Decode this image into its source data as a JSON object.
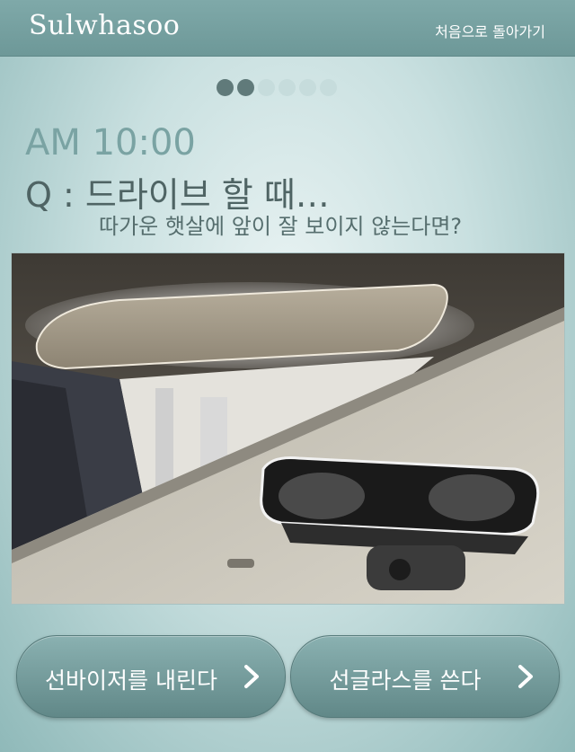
{
  "header": {
    "logo": "Sulwhasoo",
    "home_link": "처음으로 돌아가기"
  },
  "progress": {
    "current_step": 2,
    "total_steps": 6
  },
  "scenario": {
    "time": "AM 10:00",
    "question": "Q : 드라이브 할 때…",
    "subquestion": "따가운 햇살에 앞이 잘 보이지 않는다면?"
  },
  "choices": [
    {
      "label": "선바이저를 내린다",
      "icon": "chevron-right-icon"
    },
    {
      "label": "선글라스를 쓴다",
      "icon": "chevron-right-icon"
    }
  ],
  "colors": {
    "header": "#7fa9a9",
    "button": "#6f9696",
    "dot_active": "#607a7a",
    "dot_inactive": "#c6dcdc",
    "time_text": "#7aa3a3",
    "question_text": "#4f6464"
  }
}
